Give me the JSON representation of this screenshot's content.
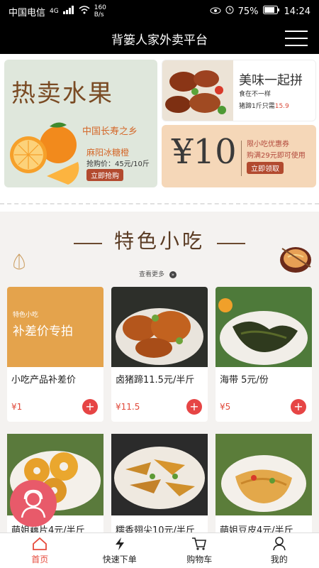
{
  "status": {
    "carrier": "中国电信",
    "network": "4G",
    "speed": "160 B/s",
    "battery": "75%",
    "time": "14:24"
  },
  "header": {
    "title": "背篓人家外卖平台"
  },
  "banners": {
    "fruit": {
      "title": "热卖水果",
      "subtitle": "中国长寿之乡",
      "name": "麻阳冰糖橙",
      "price": "抢购价：45元/10斤",
      "button": "立即抢购"
    },
    "meat": {
      "title": "美味一起拼",
      "subtitle": "食在不一样",
      "price_label": "猪蹄1斤只需",
      "price_value": "15.9"
    },
    "coupon": {
      "amount": "¥10",
      "title": "限小吃优惠券",
      "condition": "购满29元即可使用",
      "button": "立即领取"
    }
  },
  "section": {
    "title": "特色小吃",
    "see_more": "查看更多"
  },
  "products": [
    {
      "name": "小吃产品补差价",
      "price": "¥1",
      "img_caption": "特色小吃",
      "img_text": "补差价专拍"
    },
    {
      "name": "卤猪蹄11.5元/半斤",
      "price": "¥11.5"
    },
    {
      "name": "海带 5元/份",
      "price": "¥5"
    },
    {
      "name": "萌姐藕片4元/半斤"
    },
    {
      "name": "糯香翅尖10元/半斤"
    },
    {
      "name": "萌姐豆皮4元/半斤"
    }
  ],
  "tabs": [
    {
      "label": "首页",
      "icon": "home-icon"
    },
    {
      "label": "快速下单",
      "icon": "lightning-icon"
    },
    {
      "label": "购物车",
      "icon": "cart-icon"
    },
    {
      "label": "我的",
      "icon": "user-icon"
    }
  ],
  "colors": {
    "accent": "#e64a3b",
    "brand_dark": "#5a3b23"
  }
}
